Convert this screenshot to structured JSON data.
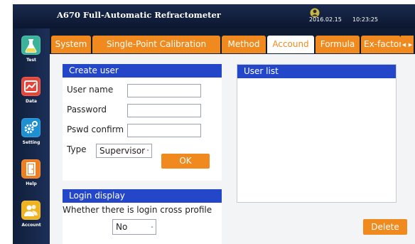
{
  "header": {
    "title": "A670 Full-Automatic Refractometer",
    "date": "2016.02.15",
    "time": "10:23:25"
  },
  "sidebar": {
    "items": [
      {
        "label": "Test",
        "icon": "flask-icon",
        "color": "#3bb39a"
      },
      {
        "label": "Data",
        "icon": "chart-icon",
        "color": "#e4463a"
      },
      {
        "label": "Setting",
        "icon": "gear-icon",
        "color": "#1d8fd3"
      },
      {
        "label": "Help",
        "icon": "door-icon",
        "color": "#f07e1e"
      },
      {
        "label": "Account",
        "icon": "users-icon",
        "color": "#f0b21e"
      }
    ]
  },
  "tabs": {
    "items": [
      {
        "label": "System",
        "active": false
      },
      {
        "label": "Single-Point Calibration",
        "active": false
      },
      {
        "label": "Method",
        "active": false
      },
      {
        "label": "Accound",
        "active": true
      },
      {
        "label": "Formula",
        "active": false
      },
      {
        "label": "Ex-factor",
        "active": false
      }
    ]
  },
  "create_user": {
    "title": "Create user",
    "username_label": "User name",
    "username_value": "",
    "password_label": "Password",
    "password_value": "",
    "confirm_label": "Pswd confirm",
    "confirm_value": "",
    "type_label": "Type",
    "type_value": "Supervisor",
    "ok_label": "OK"
  },
  "login_display": {
    "title": "Login display",
    "question": "Whether there is login cross profile",
    "value": "No"
  },
  "user_list": {
    "title": "User list",
    "users": [],
    "delete_label": "Delete"
  },
  "colors": {
    "accent": "#f08a1e",
    "header_blue": "#2447c9"
  }
}
